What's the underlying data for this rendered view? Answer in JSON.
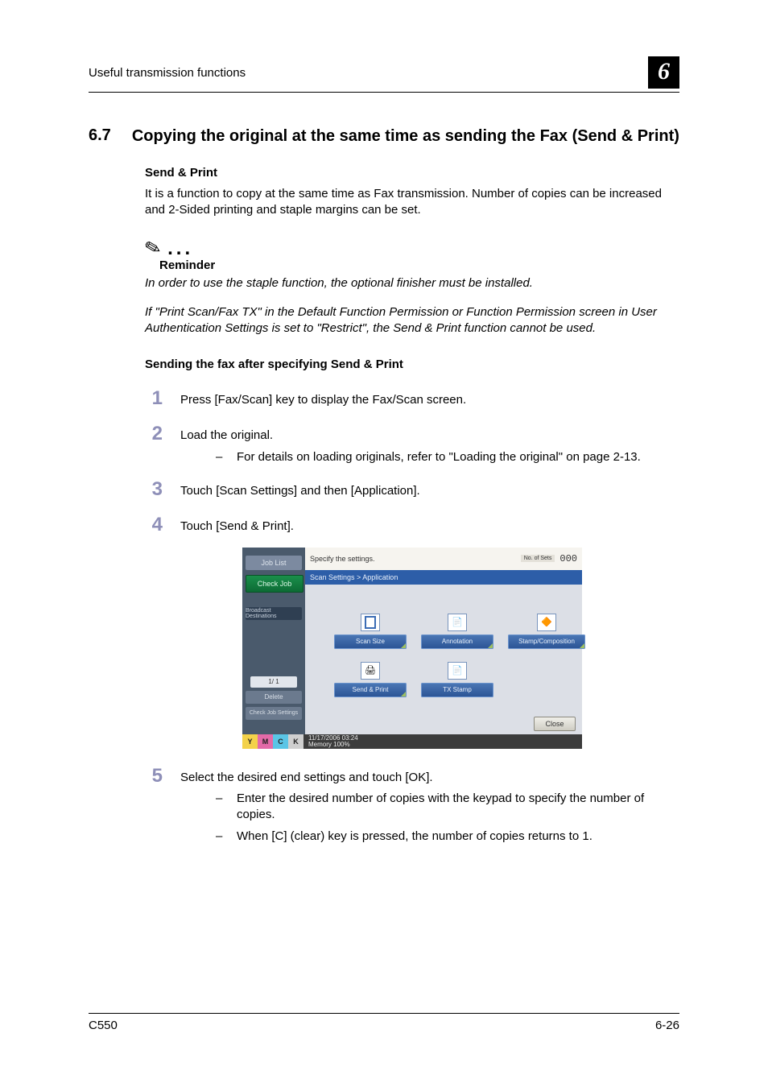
{
  "header": {
    "running": "Useful transmission functions",
    "chapter": "6"
  },
  "section": {
    "num": "6.7",
    "title": "Copying the original at the same time as sending the Fax (Send & Print)"
  },
  "sendprint": {
    "heading": "Send & Print",
    "body": "It is a function to copy at the same time as Fax transmission. Number of copies can be increased and 2-Sided printing and staple margins can be set."
  },
  "reminder": {
    "label": "Reminder",
    "p1": "In order to use the staple function, the optional finisher must be installed.",
    "p2": "If \"Print Scan/Fax TX\" in the Default Function Permission or Function Permission screen in User Authentication Settings is set to \"Restrict\", the Send & Print function cannot be used."
  },
  "proc": {
    "heading": "Sending the fax after specifying Send & Print",
    "s1": "Press [Fax/Scan] key to display the Fax/Scan screen.",
    "s2": "Load the original.",
    "s2a": "For details on loading originals, refer to \"Loading the original\" on page 2-13.",
    "s3": "Touch [Scan Settings] and then [Application].",
    "s4": "Touch [Send & Print].",
    "s5": "Select the desired end settings and touch [OK].",
    "s5a": "Enter the desired number of copies with the keypad to specify the number of copies.",
    "s5b": "When [C] (clear) key is pressed, the number of copies returns to 1."
  },
  "screenshot": {
    "joblist": "Job List",
    "checkjob": "Check Job",
    "broadcast": "Broadcast Destinations",
    "pager": "1/  1",
    "delete": "Delete",
    "checkset": "Check Job Settings",
    "topmsg": "Specify the settings.",
    "noof_label": "No. of Sets",
    "noof_value": "000",
    "tab": "Scan Settings > Application",
    "btn": {
      "scansize": "Scan Size",
      "annotation": "Annotation",
      "stampcomp": "Stamp/Composition",
      "sendprint": "Send & Print",
      "txstamp": "TX Stamp"
    },
    "close": "Close",
    "datetime": "11/17/2006  03:24",
    "memory": "Memory        100%"
  },
  "footer": {
    "left": "C550",
    "right": "6-26"
  }
}
